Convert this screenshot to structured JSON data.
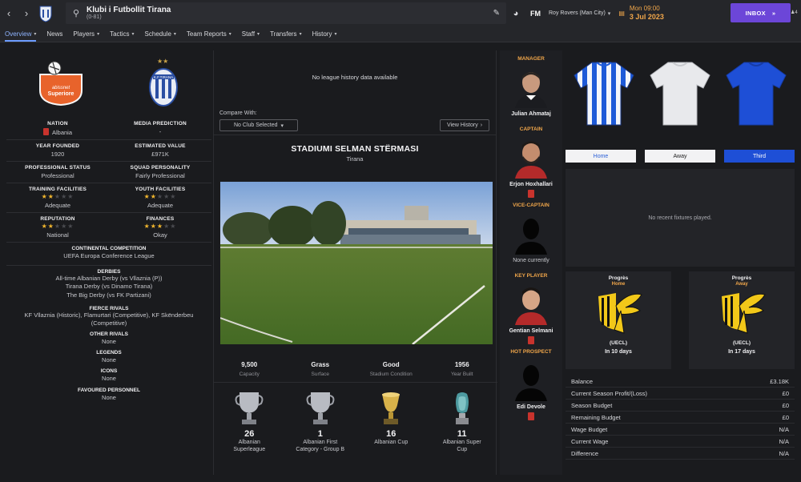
{
  "header": {
    "club_name": "Klubi i Futbollit Tirana",
    "club_sub": "(0-81)",
    "game_logo": "FM",
    "manager_team": "Roy Rovers (Man City)",
    "time": "Mon 09:00",
    "date": "3 Jul 2023",
    "inbox_label": "INBOX",
    "inbox_arrow": "»",
    "notifications": "4"
  },
  "tabs": [
    {
      "label": "Overview",
      "dropdown": true
    },
    {
      "label": "News",
      "dropdown": false
    },
    {
      "label": "Players",
      "dropdown": true
    },
    {
      "label": "Tactics",
      "dropdown": true
    },
    {
      "label": "Schedule",
      "dropdown": true
    },
    {
      "label": "Team Reports",
      "dropdown": true
    },
    {
      "label": "Staff",
      "dropdown": true
    },
    {
      "label": "Transfers",
      "dropdown": true
    },
    {
      "label": "History",
      "dropdown": true
    }
  ],
  "club_info": {
    "league_badge": "Abissnet Superiore",
    "nation_label": "NATION",
    "nation": "Albania",
    "media_label": "MEDIA PREDICTION",
    "media": "-",
    "founded_label": "YEAR FOUNDED",
    "founded": "1920",
    "value_label": "ESTIMATED VALUE",
    "value": "£971K",
    "pro_label": "PROFESSIONAL STATUS",
    "pro": "Professional",
    "personality_label": "SQUAD PERSONALITY",
    "personality": "Fairly Professional",
    "training_label": "TRAINING FACILITIES",
    "training": "Adequate",
    "training_stars": 2,
    "youth_label": "YOUTH FACILITIES",
    "youth": "Adequate",
    "youth_stars": 2,
    "reputation_label": "REPUTATION",
    "reputation": "National",
    "reputation_stars": 2,
    "finances_label": "FINANCES",
    "finances": "Okay",
    "finances_stars": 3,
    "continental_label": "CONTINENTAL COMPETITION",
    "continental": "UEFA Europa Conference League",
    "derbies_label": "DERBIES",
    "derbies": [
      "All-time Albanian Derby (vs Vllaznia (P))",
      "Tirana Derby (vs Dinamo Tirana)",
      "The Big Derby (vs FK Partizani)"
    ],
    "fierce_label": "FIERCE RIVALS",
    "fierce": "KF Vllaznia (Historic), Flamurtari (Competitive), KF Skënderbeu (Competitive)",
    "other_label": "OTHER RIVALS",
    "other": "None",
    "legends_label": "LEGENDS",
    "legends": "None",
    "icons_label": "ICONS",
    "icons": "None",
    "favoured_label": "FAVOURED PERSONNEL",
    "favoured": "None"
  },
  "history": {
    "empty_text": "No league history data available",
    "compare_label": "Compare With:",
    "compare_value": "No Club Selected",
    "view_history": "View History"
  },
  "stadium": {
    "name": "STADIUMI SELMAN STËRMASI",
    "city": "Tirana",
    "stats": [
      {
        "value": "9,500",
        "label": "Capacity"
      },
      {
        "value": "Grass",
        "label": "Surface"
      },
      {
        "value": "Good",
        "label": "Stadium Condition"
      },
      {
        "value": "1956",
        "label": "Year Built"
      }
    ]
  },
  "trophies": [
    {
      "count": "26",
      "name": "Albanian Superleague"
    },
    {
      "count": "1",
      "name": "Albanian First Category - Group B"
    },
    {
      "count": "16",
      "name": "Albanian Cup"
    },
    {
      "count": "11",
      "name": "Albanian Super Cup"
    }
  ],
  "staff": [
    {
      "role": "MANAGER",
      "name": "Julian Ahmataj"
    },
    {
      "role": "CAPTAIN",
      "name": "Erjon Hoxhallari"
    },
    {
      "role": "VICE-CAPTAIN",
      "name": "None currently"
    },
    {
      "role": "KEY PLAYER",
      "name": "Gentian Selmani"
    },
    {
      "role": "HOT PROSPECT",
      "name": "Edi Devole"
    }
  ],
  "kits": {
    "tabs": [
      "Home",
      "Away",
      "Third"
    ],
    "colors": {
      "home_stripe": "#1e5ad8",
      "third": "#1e4fd6",
      "accent": "#6c46d8",
      "orange": "#f0a64a"
    }
  },
  "fixtures": {
    "empty_text": "No recent fixtures played."
  },
  "next_matches": [
    {
      "opponent": "Progrès",
      "venue": "Home",
      "comp": "(UECL)",
      "when": "In 10 days"
    },
    {
      "opponent": "Progrès",
      "venue": "Away",
      "comp": "(UECL)",
      "when": "In 17 days"
    }
  ],
  "finance": [
    {
      "label": "Balance",
      "value": "£3.18K"
    },
    {
      "label": "Current Season Profit/(Loss)",
      "value": "£0"
    },
    {
      "label": "Season Budget",
      "value": "£0"
    },
    {
      "label": "Remaining Budget",
      "value": "£0"
    },
    {
      "label": "Wage Budget",
      "value": "N/A"
    },
    {
      "label": "Current Wage",
      "value": "N/A"
    },
    {
      "label": "Difference",
      "value": "N/A"
    }
  ]
}
